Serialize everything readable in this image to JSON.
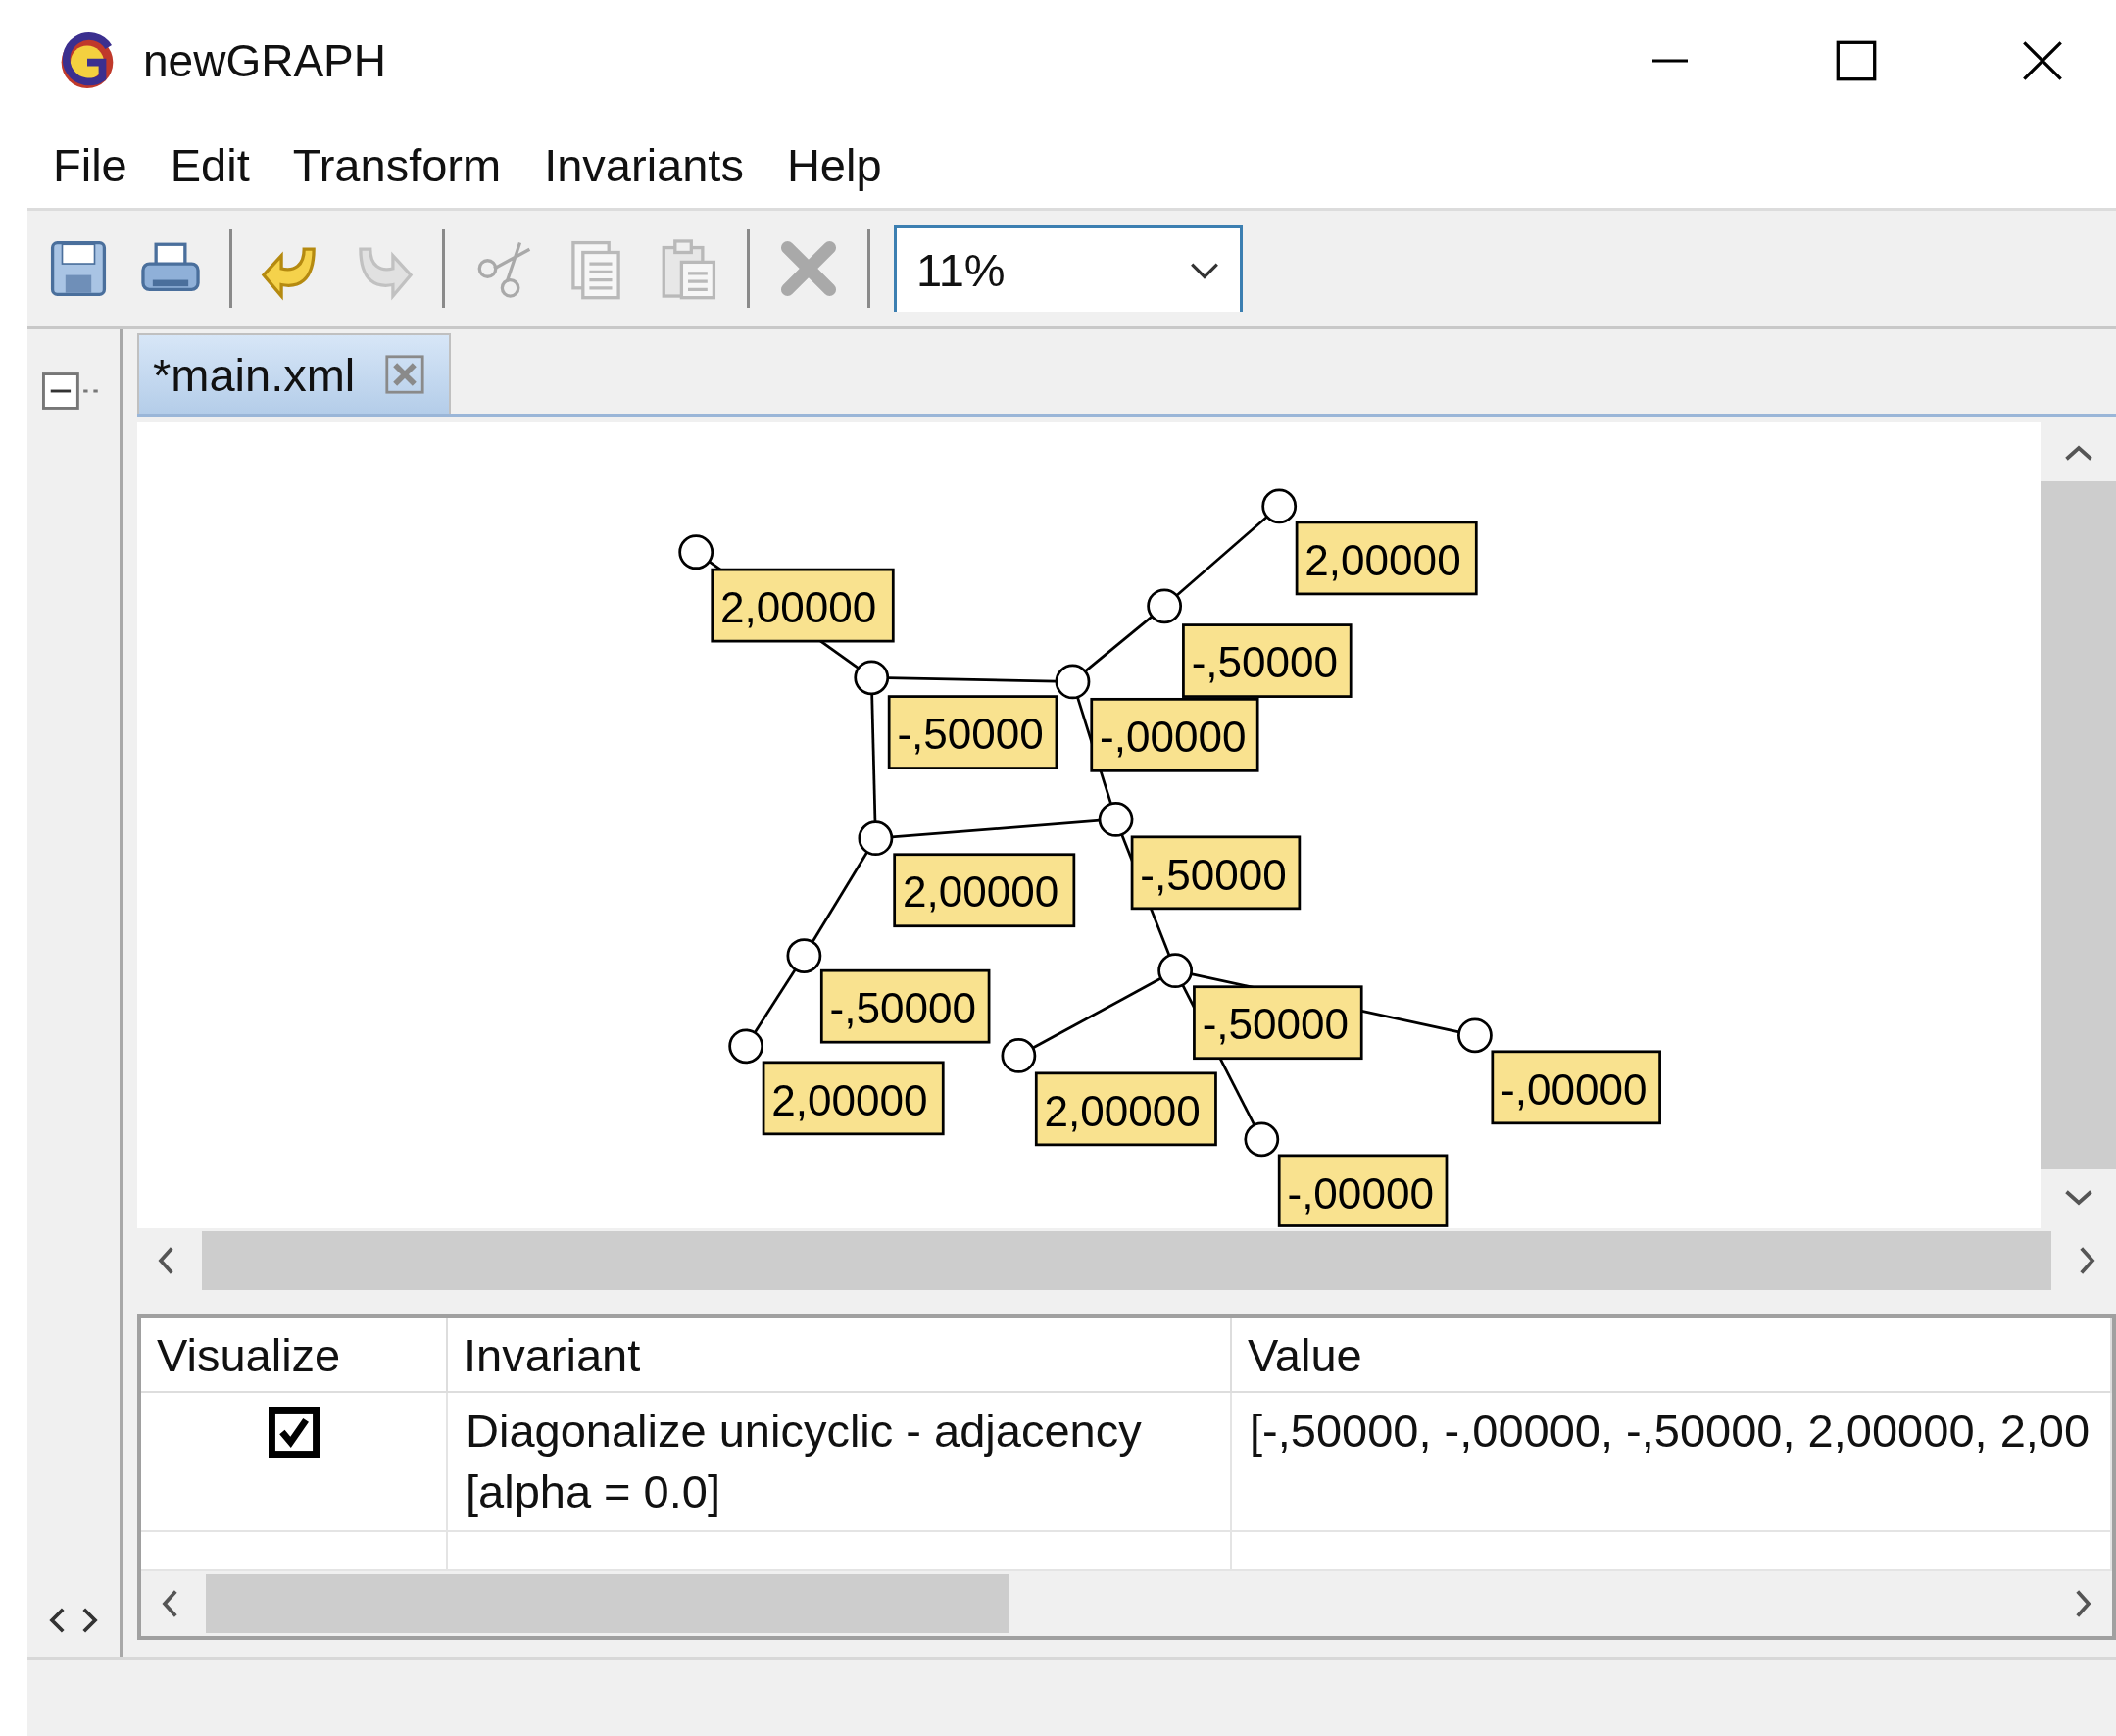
{
  "window": {
    "title": "newGRAPH"
  },
  "menu": [
    "File",
    "Edit",
    "Transform",
    "Invariants",
    "Help"
  ],
  "toolbar": {
    "buttons": [
      {
        "kind": "save",
        "disabled": false
      },
      {
        "kind": "print",
        "disabled": false
      },
      {
        "kind": "separator"
      },
      {
        "kind": "undo",
        "disabled": false
      },
      {
        "kind": "redo",
        "disabled": true
      },
      {
        "kind": "separator"
      },
      {
        "kind": "cut",
        "disabled": true
      },
      {
        "kind": "copy",
        "disabled": true
      },
      {
        "kind": "paste",
        "disabled": true
      },
      {
        "kind": "separator"
      },
      {
        "kind": "delete",
        "disabled": true
      },
      {
        "kind": "separator"
      }
    ],
    "zoom": "11%"
  },
  "tabs": [
    {
      "label": "*main.xml",
      "selected": true
    }
  ],
  "graph": {
    "node_labels": [
      "2,00000",
      "2,00000",
      "-,50000",
      "-,50000",
      "-,00000",
      "2,00000",
      "-,50000",
      "-,50000",
      "2,00000",
      "-,50000",
      "2,00000",
      "-,00000",
      "-,00000"
    ]
  },
  "table": {
    "columns": [
      "Visualize",
      "Invariant",
      "Value"
    ],
    "rows": [
      {
        "visualize": true,
        "invariant": "Diagonalize unicyclic - adjacency [alpha = 0.0]",
        "value": "[-,50000, -,00000, -,50000, 2,00000, 2,00"
      }
    ]
  }
}
